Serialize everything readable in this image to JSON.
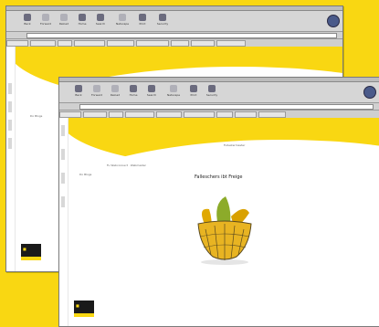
{
  "toolbar": {
    "buttons": [
      "Back",
      "Forward",
      "Reload",
      "Home",
      "Search",
      "Netscape",
      "Print",
      "Security",
      "Stop"
    ]
  },
  "back_window": {
    "side_note": "Do Blogs"
  },
  "front_window": {
    "nav_link_1": "Do Blogs",
    "nav_link_2": "Fu Webconnect · Webmaster",
    "nav_link_3": "Fullestermaster",
    "heading": "Falleschers ibt Freige",
    "side_labels": [
      "Seite",
      "Daten",
      "Kontakt",
      "Impressum"
    ]
  },
  "colors": {
    "brand_yellow": "#f9d712",
    "chrome_gray": "#d6d6d6"
  }
}
